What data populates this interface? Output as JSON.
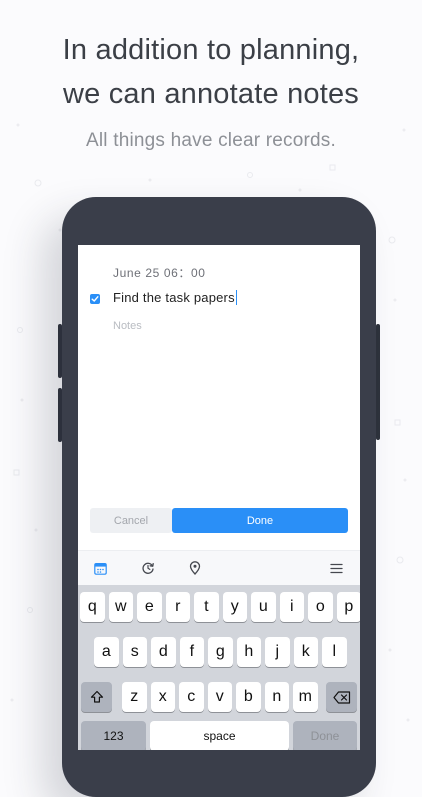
{
  "headline": {
    "line1": "In addition to planning,",
    "line2": "we can annotate notes"
  },
  "subline": "All things have clear records.",
  "task": {
    "date": "June 25 06：00",
    "title": "Find the task papers",
    "checked": true,
    "notes_placeholder": "Notes"
  },
  "actions": {
    "cancel": "Cancel",
    "done": "Done"
  },
  "toolbar": {
    "icons": [
      "calendar-icon",
      "repeat-icon",
      "location-icon",
      "menu-icon"
    ]
  },
  "keyboard": {
    "row1": [
      "q",
      "w",
      "e",
      "r",
      "t",
      "y",
      "u",
      "i",
      "o",
      "p"
    ],
    "row2": [
      "a",
      "s",
      "d",
      "f",
      "g",
      "h",
      "j",
      "k",
      "l"
    ],
    "row3": [
      "z",
      "x",
      "c",
      "v",
      "b",
      "n",
      "m"
    ],
    "numbers": "123",
    "space": "space",
    "done": "Done"
  },
  "colors": {
    "accent": "#2a8ff7",
    "phone_body": "#3a3e4a",
    "headline_text": "#3b3f46",
    "keyboard_bg": "#d2d5db"
  }
}
